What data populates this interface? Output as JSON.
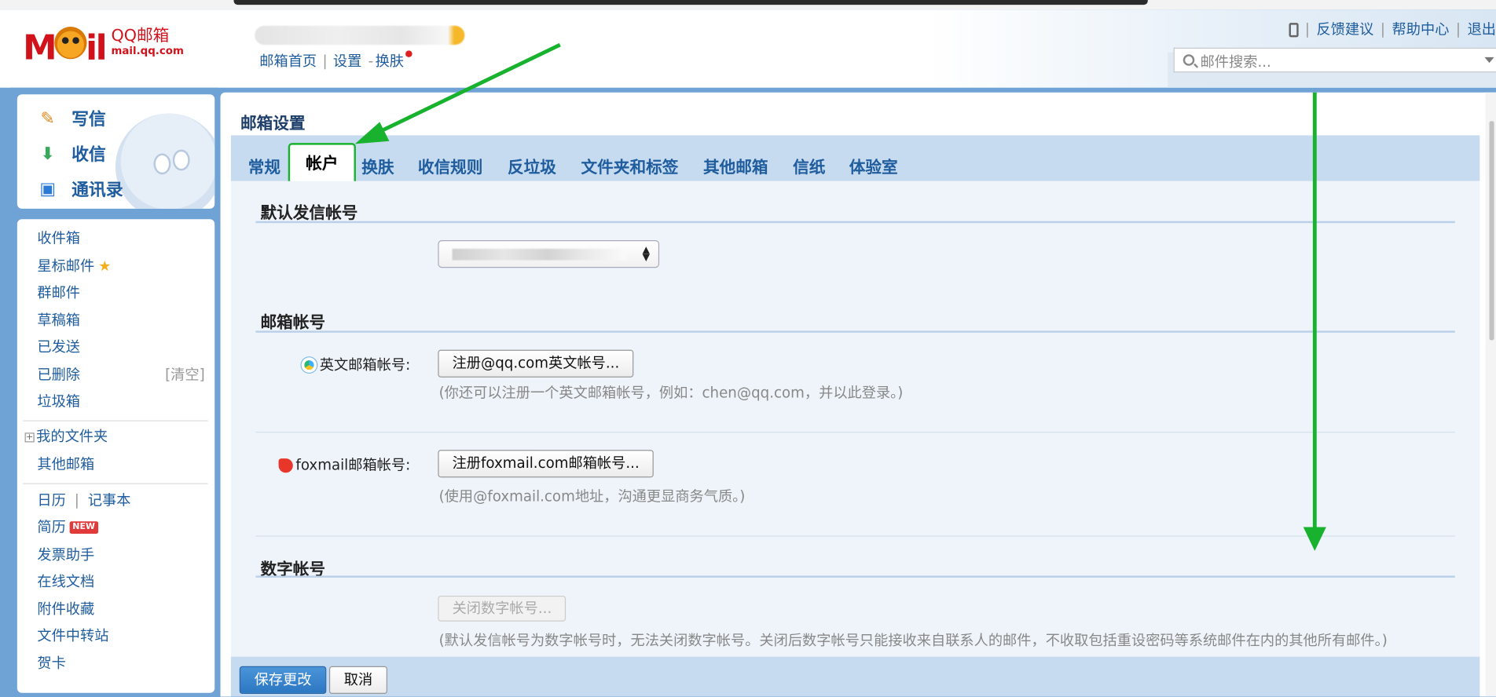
{
  "header": {
    "brand_logo_text": "Mail",
    "brand_name": "QQ邮箱",
    "brand_domain": "mail.qq.com",
    "nav": {
      "home": "邮箱首页",
      "sep": "|",
      "settings": "设置",
      "dash": "-",
      "skin": "换肤"
    },
    "links": {
      "feedback": "反馈建议",
      "help": "帮助中心",
      "logout": "退出",
      "sep": "|"
    },
    "search_placeholder": "邮件搜索..."
  },
  "sidebar": {
    "quick": [
      {
        "label": "写信",
        "icon": "compose-icon"
      },
      {
        "label": "收信",
        "icon": "inbox-download-icon"
      },
      {
        "label": "通讯录",
        "icon": "contacts-icon"
      }
    ],
    "folders": {
      "inbox": "收件箱",
      "starred": "星标邮件",
      "group": "群邮件",
      "drafts": "草稿箱",
      "sent": "已发送",
      "deleted": "已删除",
      "deleted_clear": "[清空]",
      "spam": "垃圾箱",
      "my_folders": "我的文件夹",
      "other_mail": "其他邮箱",
      "calendar": "日历",
      "tool_sep": "|",
      "notes": "记事本",
      "resume": "简历",
      "resume_badge": "NEW",
      "invoice": "发票助手",
      "docs": "在线文档",
      "attachments": "附件收藏",
      "transfer": "文件中转站",
      "cards": "贺卡"
    }
  },
  "main": {
    "title": "邮箱设置",
    "tabs": [
      "常规",
      "帐户",
      "换肤",
      "收信规则",
      "反垃圾",
      "文件夹和标签",
      "其他邮箱",
      "信纸",
      "体验室"
    ],
    "active_tab": "帐户",
    "sections": {
      "default_sender": "默认发信帐号",
      "mailbox_account": "邮箱帐号",
      "digital_account": "数字帐号"
    },
    "english_label": "英文邮箱帐号:",
    "english_button": "注册@qq.com英文帐号...",
    "english_hint": "(你还可以注册一个英文邮箱帐号，例如：chen@qq.com，并以此登录。)",
    "foxmail_label": "foxmail邮箱帐号:",
    "foxmail_button": "注册foxmail.com邮箱帐号...",
    "foxmail_hint": "(使用@foxmail.com地址，沟通更显商务气质。)",
    "digital_button": "关闭数字帐号...",
    "digital_hint": "(默认发信帐号为数字帐号时，无法关闭数字帐号。关闭后数字帐号只能接收来自联系人的邮件，不收取包括重设密码等系统邮件在内的其他所有邮件。)",
    "save_button": "保存更改",
    "cancel_button": "取消"
  },
  "colors": {
    "accent_arrow": "#19b22f",
    "link": "#1f5d9e",
    "frame": "#6fa3d6",
    "brand_red": "#d2121b"
  }
}
